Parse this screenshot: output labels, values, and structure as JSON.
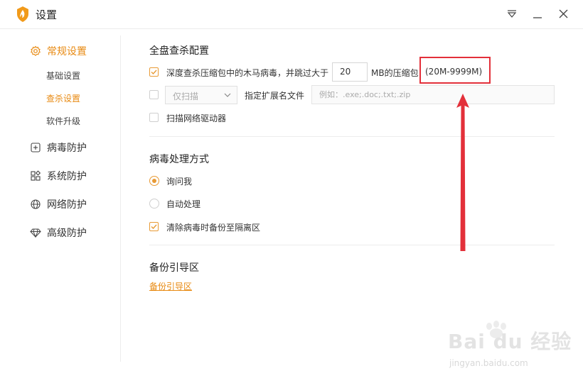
{
  "window": {
    "title": "设置"
  },
  "sidebar": {
    "items": [
      {
        "label": "常规设置",
        "icon": "gear-icon",
        "active": true
      },
      {
        "label": "病毒防护",
        "icon": "plus-square-icon"
      },
      {
        "label": "系统防护",
        "icon": "grid-icon"
      },
      {
        "label": "网络防护",
        "icon": "globe-icon"
      },
      {
        "label": "高级防护",
        "icon": "diamond-icon"
      }
    ],
    "subitems": [
      {
        "label": "基础设置"
      },
      {
        "label": "查杀设置",
        "active": true
      },
      {
        "label": "软件升级"
      }
    ]
  },
  "scan": {
    "title": "全盘查杀配置",
    "deep_label": "深度查杀压缩包中的木马病毒，并跳过大于",
    "size_value": "20",
    "size_unit": "MB的压缩包",
    "size_range": "(20M-9999M)",
    "scan_mode": "仅扫描",
    "ext_label": "指定扩展名文件",
    "ext_placeholder": "例如：.exe;.doc;.txt;.zip",
    "network_label": "扫描网络驱动器"
  },
  "virus": {
    "title": "病毒处理方式",
    "ask_label": "询问我",
    "auto_label": "自动处理",
    "backup_label": "清除病毒时备份至隔离区"
  },
  "boot": {
    "title": "备份引导区",
    "link": "备份引导区"
  },
  "watermark": {
    "brand": "Bai du 经验",
    "url": "jingyan.baidu.com"
  },
  "colors": {
    "accent": "#e88a12",
    "annotation_red": "#e3303a"
  }
}
